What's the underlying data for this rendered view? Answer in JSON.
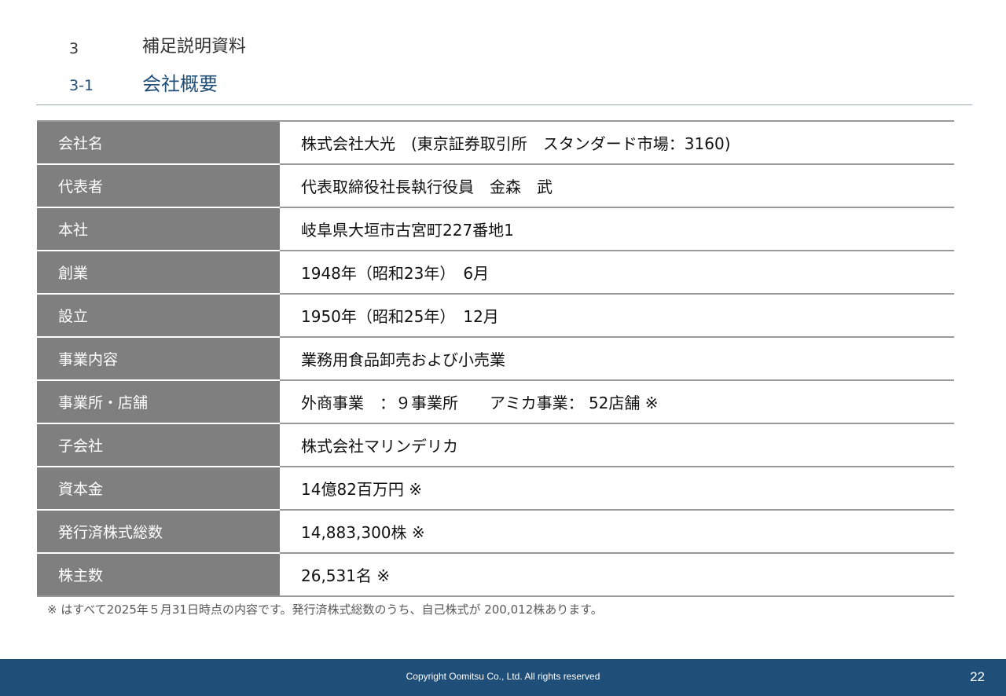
{
  "header": {
    "section_number": "3",
    "section_title": "補足説明資料",
    "subsection_number": "3-1",
    "subsection_title": "会社概要"
  },
  "company_table": {
    "rows": [
      {
        "label": "会社名",
        "value": "株式会社大光　(東京証券取引所　スタンダード市場：3160)"
      },
      {
        "label": "代表者",
        "value": "代表取締役社長執行役員　金森　武"
      },
      {
        "label": "本社",
        "value": "岐阜県大垣市古宮町227番地1"
      },
      {
        "label": "創業",
        "value": "1948年（昭和23年）　6月"
      },
      {
        "label": "設立",
        "value": "1950年（昭和25年）　12月"
      },
      {
        "label": "事業内容",
        "value": "業務用食品卸売および小売業"
      },
      {
        "label": "事業所・店舗",
        "value": "外商事業　：９事業所　　アミカ事業： 52店舗 ※"
      },
      {
        "label": "子会社",
        "value": "株式会社マリンデリカ"
      },
      {
        "label": "資本金",
        "value": "14億82百万円 ※"
      },
      {
        "label": "発行済株式総数",
        "value": "14,883,300株 ※"
      },
      {
        "label": "株主数",
        "value": "26,531名 ※"
      }
    ]
  },
  "footnote": "※ はすべて2025年５月31日時点の内容です。発行済株式総数のうち、自己株式が 200,012株あります。",
  "footer": {
    "copyright": "Copyright Oomitsu Co., Ltd. All rights reserved",
    "page_number": "22"
  },
  "colors": {
    "accent": "#1f4e79",
    "label_bg": "#7f7f7f",
    "rule": "#9a9a9a"
  }
}
